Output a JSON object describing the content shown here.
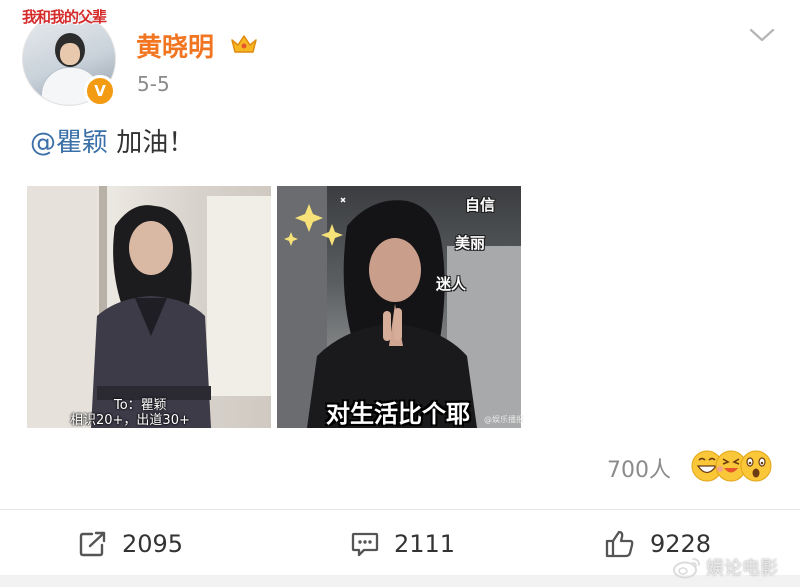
{
  "post": {
    "avatar_caption": "我和我的父辈",
    "verified_mark": "V",
    "username": "黄晓明",
    "date": "5-5",
    "mention": "@瞿颖",
    "text_rest": " 加油！",
    "images": [
      {
        "caption_lines": [
          "To：瞿颖",
          "相识20+，出道30+"
        ]
      },
      {
        "stickers": [
          "自信",
          "美丽",
          "迷人"
        ],
        "caption": "对生活比个耶",
        "watermark": "@娱乐播报"
      }
    ],
    "reactions": {
      "count_text": "700人",
      "icons": [
        "grin-emoji-icon",
        "laugh-emoji-icon",
        "surprised-emoji-icon"
      ]
    },
    "actions": {
      "repost_count": "2095",
      "comment_count": "2111",
      "like_count": "9228"
    },
    "footer_watermark": "娱论电影"
  },
  "colors": {
    "username": "#f27622",
    "mention": "#3a6fa8",
    "badge": "#f29b13",
    "muted": "#8b8b8b",
    "text": "#333333"
  }
}
